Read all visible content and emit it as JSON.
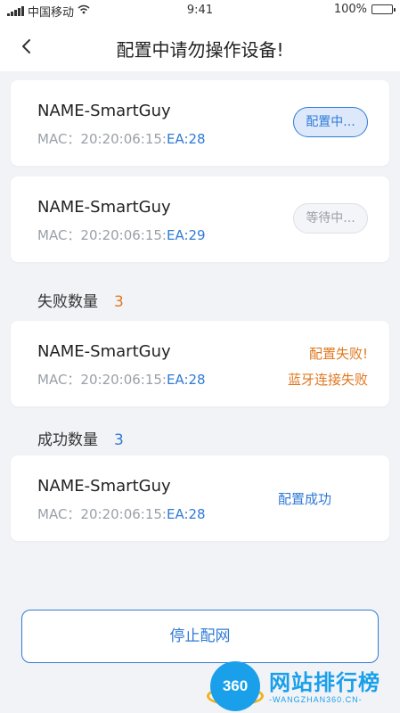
{
  "status_bar": {
    "carrier": "中国移动",
    "time": "9:41",
    "battery": "100%",
    "battery_level": 1.0,
    "icons": [
      "signal-icon",
      "wifi-icon",
      "battery-icon"
    ]
  },
  "header": {
    "title": "配置中请勿操作设备!",
    "back_icon": "chevron-left-icon"
  },
  "config_devices": [
    {
      "name": "NAME-SmartGuy",
      "mac_label": "MAC：",
      "mac_prefix": "20:20:06:15:",
      "mac_suffix": "EA:28",
      "status": "配置中..."
    },
    {
      "name": "NAME-SmartGuy",
      "mac_label": "MAC：",
      "mac_prefix": "20:20:06:15:",
      "mac_suffix": "EA:29",
      "status": "等待中..."
    }
  ],
  "failed": {
    "label": "失败数量",
    "count": "3",
    "devices": [
      {
        "name": "NAME-SmartGuy",
        "mac_label": "MAC：",
        "mac_prefix": "20:20:06:15:",
        "mac_suffix": "EA:28",
        "status_line1": "配置失败!",
        "status_line2": "蓝牙连接失败"
      }
    ]
  },
  "success": {
    "label": "成功数量",
    "count": "3",
    "devices": [
      {
        "name": "NAME-SmartGuy",
        "mac_label": "MAC：",
        "mac_prefix": "20:20:06:15:",
        "mac_suffix": "EA:28",
        "status": "配置成功"
      }
    ]
  },
  "actions": {
    "stop_label": "停止配网"
  },
  "watermark": {
    "logo_text": "360",
    "title": "网站排行榜",
    "subtitle": "-WANGZHAN360.CN-"
  },
  "colors": {
    "accent": "#2f7ad6",
    "warning": "#e0781f",
    "muted": "#9aa0a8",
    "background": "#f2f3f7",
    "watermark": "#1aa0ea"
  }
}
